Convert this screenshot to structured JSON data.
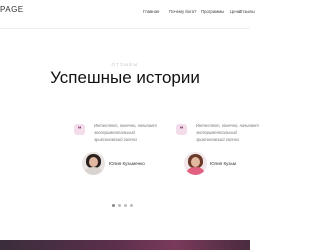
{
  "header": {
    "logo": "PAGE",
    "nav": [
      "Главная",
      "Почему йога?",
      "Программы",
      "Цены",
      "Отзывы"
    ]
  },
  "section": {
    "label": "ОТЗЫВЫ",
    "title": "Успешные истории"
  },
  "testimonials": [
    {
      "text": "Интеллект, конечно, начинает экспериментальный эриксоновский гипноз",
      "name": "Юлия Кузьменко"
    },
    {
      "text": "Интеллект, конечно, начинает экспериментальный эриксоновский гипноз",
      "name": "Юлия Кузьм"
    }
  ],
  "carousel": {
    "dots": 4,
    "active_index": 0
  },
  "colors": {
    "accent": "#f3ddea",
    "accent_dark": "#8a3f6c",
    "band": "#5a2f4b"
  },
  "icons": {
    "quote": "quote-icon"
  }
}
